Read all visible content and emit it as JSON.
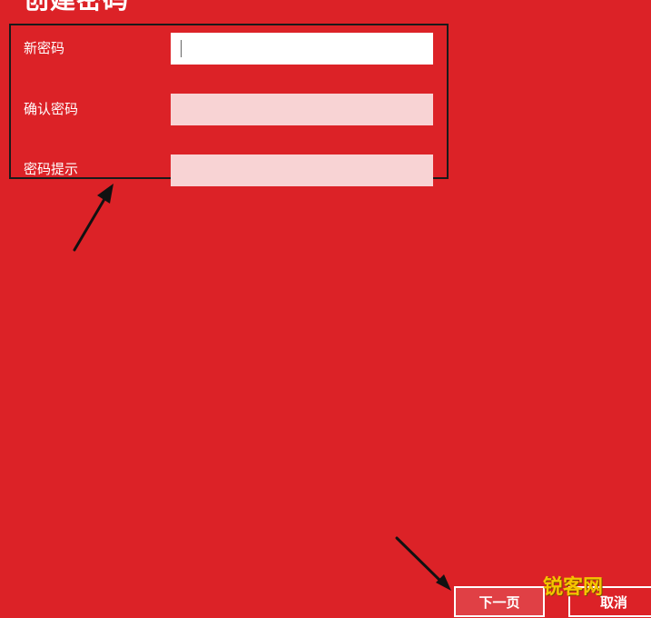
{
  "page": {
    "title": "创建密码"
  },
  "form": {
    "fields": [
      {
        "label": "新密码",
        "value": "",
        "state": "focused"
      },
      {
        "label": "确认密码",
        "value": "",
        "state": "disabled"
      },
      {
        "label": "密码提示",
        "value": "",
        "state": "disabled"
      }
    ]
  },
  "buttons": {
    "next_label": "下一页",
    "cancel_label": "取消"
  },
  "watermark": {
    "text": "锐客网"
  },
  "colors": {
    "background": "#dc2227",
    "input_active": "#ffffff",
    "input_inactive": "#f8d3d4",
    "annotation": "#1a1a1a",
    "watermark": "#f5c400"
  }
}
